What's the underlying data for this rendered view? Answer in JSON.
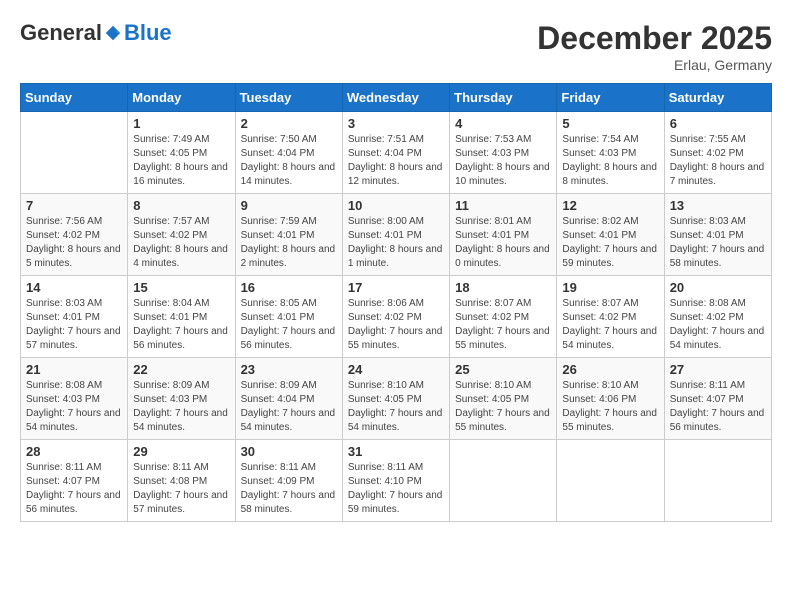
{
  "header": {
    "logo_general": "General",
    "logo_blue": "Blue",
    "month_title": "December 2025",
    "location": "Erlau, Germany"
  },
  "weekdays": [
    "Sunday",
    "Monday",
    "Tuesday",
    "Wednesday",
    "Thursday",
    "Friday",
    "Saturday"
  ],
  "weeks": [
    [
      {
        "day": "",
        "sunrise": "",
        "sunset": "",
        "daylight": ""
      },
      {
        "day": "1",
        "sunrise": "Sunrise: 7:49 AM",
        "sunset": "Sunset: 4:05 PM",
        "daylight": "Daylight: 8 hours and 16 minutes."
      },
      {
        "day": "2",
        "sunrise": "Sunrise: 7:50 AM",
        "sunset": "Sunset: 4:04 PM",
        "daylight": "Daylight: 8 hours and 14 minutes."
      },
      {
        "day": "3",
        "sunrise": "Sunrise: 7:51 AM",
        "sunset": "Sunset: 4:04 PM",
        "daylight": "Daylight: 8 hours and 12 minutes."
      },
      {
        "day": "4",
        "sunrise": "Sunrise: 7:53 AM",
        "sunset": "Sunset: 4:03 PM",
        "daylight": "Daylight: 8 hours and 10 minutes."
      },
      {
        "day": "5",
        "sunrise": "Sunrise: 7:54 AM",
        "sunset": "Sunset: 4:03 PM",
        "daylight": "Daylight: 8 hours and 8 minutes."
      },
      {
        "day": "6",
        "sunrise": "Sunrise: 7:55 AM",
        "sunset": "Sunset: 4:02 PM",
        "daylight": "Daylight: 8 hours and 7 minutes."
      }
    ],
    [
      {
        "day": "7",
        "sunrise": "Sunrise: 7:56 AM",
        "sunset": "Sunset: 4:02 PM",
        "daylight": "Daylight: 8 hours and 5 minutes."
      },
      {
        "day": "8",
        "sunrise": "Sunrise: 7:57 AM",
        "sunset": "Sunset: 4:02 PM",
        "daylight": "Daylight: 8 hours and 4 minutes."
      },
      {
        "day": "9",
        "sunrise": "Sunrise: 7:59 AM",
        "sunset": "Sunset: 4:01 PM",
        "daylight": "Daylight: 8 hours and 2 minutes."
      },
      {
        "day": "10",
        "sunrise": "Sunrise: 8:00 AM",
        "sunset": "Sunset: 4:01 PM",
        "daylight": "Daylight: 8 hours and 1 minute."
      },
      {
        "day": "11",
        "sunrise": "Sunrise: 8:01 AM",
        "sunset": "Sunset: 4:01 PM",
        "daylight": "Daylight: 8 hours and 0 minutes."
      },
      {
        "day": "12",
        "sunrise": "Sunrise: 8:02 AM",
        "sunset": "Sunset: 4:01 PM",
        "daylight": "Daylight: 7 hours and 59 minutes."
      },
      {
        "day": "13",
        "sunrise": "Sunrise: 8:03 AM",
        "sunset": "Sunset: 4:01 PM",
        "daylight": "Daylight: 7 hours and 58 minutes."
      }
    ],
    [
      {
        "day": "14",
        "sunrise": "Sunrise: 8:03 AM",
        "sunset": "Sunset: 4:01 PM",
        "daylight": "Daylight: 7 hours and 57 minutes."
      },
      {
        "day": "15",
        "sunrise": "Sunrise: 8:04 AM",
        "sunset": "Sunset: 4:01 PM",
        "daylight": "Daylight: 7 hours and 56 minutes."
      },
      {
        "day": "16",
        "sunrise": "Sunrise: 8:05 AM",
        "sunset": "Sunset: 4:01 PM",
        "daylight": "Daylight: 7 hours and 56 minutes."
      },
      {
        "day": "17",
        "sunrise": "Sunrise: 8:06 AM",
        "sunset": "Sunset: 4:02 PM",
        "daylight": "Daylight: 7 hours and 55 minutes."
      },
      {
        "day": "18",
        "sunrise": "Sunrise: 8:07 AM",
        "sunset": "Sunset: 4:02 PM",
        "daylight": "Daylight: 7 hours and 55 minutes."
      },
      {
        "day": "19",
        "sunrise": "Sunrise: 8:07 AM",
        "sunset": "Sunset: 4:02 PM",
        "daylight": "Daylight: 7 hours and 54 minutes."
      },
      {
        "day": "20",
        "sunrise": "Sunrise: 8:08 AM",
        "sunset": "Sunset: 4:02 PM",
        "daylight": "Daylight: 7 hours and 54 minutes."
      }
    ],
    [
      {
        "day": "21",
        "sunrise": "Sunrise: 8:08 AM",
        "sunset": "Sunset: 4:03 PM",
        "daylight": "Daylight: 7 hours and 54 minutes."
      },
      {
        "day": "22",
        "sunrise": "Sunrise: 8:09 AM",
        "sunset": "Sunset: 4:03 PM",
        "daylight": "Daylight: 7 hours and 54 minutes."
      },
      {
        "day": "23",
        "sunrise": "Sunrise: 8:09 AM",
        "sunset": "Sunset: 4:04 PM",
        "daylight": "Daylight: 7 hours and 54 minutes."
      },
      {
        "day": "24",
        "sunrise": "Sunrise: 8:10 AM",
        "sunset": "Sunset: 4:05 PM",
        "daylight": "Daylight: 7 hours and 54 minutes."
      },
      {
        "day": "25",
        "sunrise": "Sunrise: 8:10 AM",
        "sunset": "Sunset: 4:05 PM",
        "daylight": "Daylight: 7 hours and 55 minutes."
      },
      {
        "day": "26",
        "sunrise": "Sunrise: 8:10 AM",
        "sunset": "Sunset: 4:06 PM",
        "daylight": "Daylight: 7 hours and 55 minutes."
      },
      {
        "day": "27",
        "sunrise": "Sunrise: 8:11 AM",
        "sunset": "Sunset: 4:07 PM",
        "daylight": "Daylight: 7 hours and 56 minutes."
      }
    ],
    [
      {
        "day": "28",
        "sunrise": "Sunrise: 8:11 AM",
        "sunset": "Sunset: 4:07 PM",
        "daylight": "Daylight: 7 hours and 56 minutes."
      },
      {
        "day": "29",
        "sunrise": "Sunrise: 8:11 AM",
        "sunset": "Sunset: 4:08 PM",
        "daylight": "Daylight: 7 hours and 57 minutes."
      },
      {
        "day": "30",
        "sunrise": "Sunrise: 8:11 AM",
        "sunset": "Sunset: 4:09 PM",
        "daylight": "Daylight: 7 hours and 58 minutes."
      },
      {
        "day": "31",
        "sunrise": "Sunrise: 8:11 AM",
        "sunset": "Sunset: 4:10 PM",
        "daylight": "Daylight: 7 hours and 59 minutes."
      },
      {
        "day": "",
        "sunrise": "",
        "sunset": "",
        "daylight": ""
      },
      {
        "day": "",
        "sunrise": "",
        "sunset": "",
        "daylight": ""
      },
      {
        "day": "",
        "sunrise": "",
        "sunset": "",
        "daylight": ""
      }
    ]
  ]
}
